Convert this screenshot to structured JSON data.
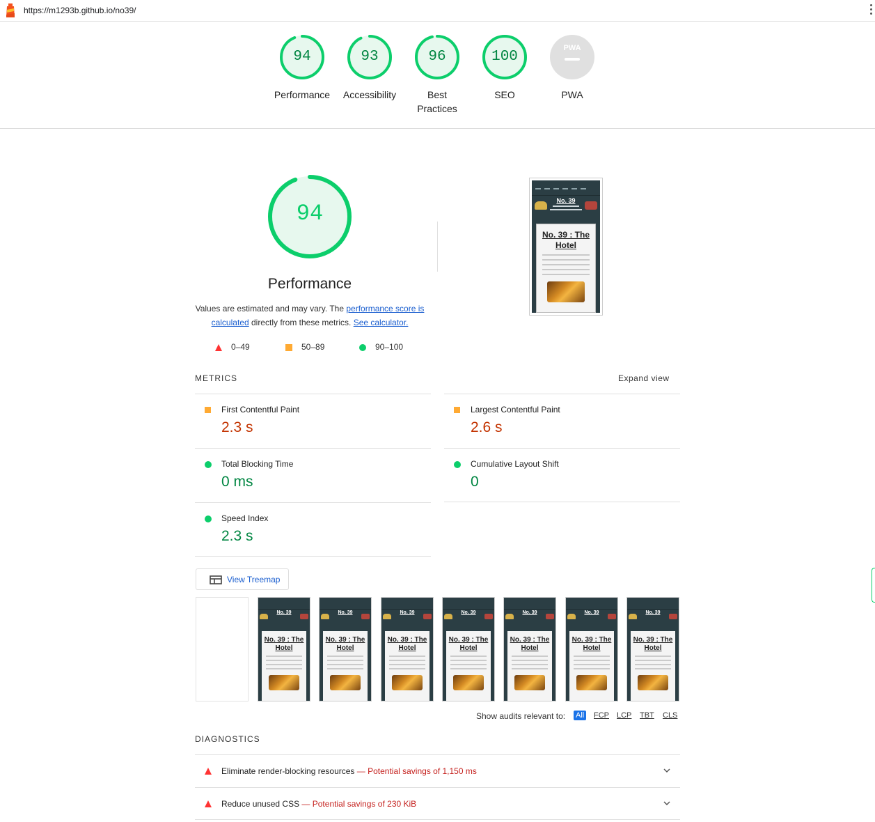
{
  "browser": {
    "url": "https://m1293b.github.io/no39/",
    "logo_icon": "lighthouse-icon"
  },
  "gauges": [
    {
      "label": "Performance",
      "score": "94",
      "color": "#0cce6b"
    },
    {
      "label": "Accessibility",
      "score": "93",
      "color": "#0cce6b"
    },
    {
      "label": "Best Practices",
      "score": "96",
      "color": "#0cce6b"
    },
    {
      "label": "SEO",
      "score": "100",
      "color": "#0cce6b"
    },
    {
      "label": "PWA",
      "score": "",
      "badge": "PWA",
      "color": "#cccccc"
    }
  ],
  "performance": {
    "score": "94",
    "title": "Performance",
    "desc_pre": "Values are estimated and may vary. The ",
    "link_score": "performance score is calculated",
    "desc_mid": " directly from these metrics. ",
    "link_calc": "See calculator.",
    "legend": [
      {
        "icon": "red-triangle-icon",
        "range": "0–49",
        "color": "#ff3333"
      },
      {
        "icon": "orange-square-icon",
        "range": "50–89",
        "color": "#ffaa33"
      },
      {
        "icon": "green-circle-icon",
        "range": "90–100",
        "color": "#0cce6b"
      }
    ]
  },
  "final_screenshot": {
    "site_title": "No. 39",
    "headline": "No. 39 : The Hotel"
  },
  "metrics": {
    "title": "METRICS",
    "expand": "Expand view",
    "items": [
      {
        "label": "First Contentful Paint",
        "value": "2.3 s",
        "rating": "average"
      },
      {
        "label": "Largest Contentful Paint",
        "value": "2.6 s",
        "rating": "average"
      },
      {
        "label": "Total Blocking Time",
        "value": "0 ms",
        "rating": "pass"
      },
      {
        "label": "Cumulative Layout Shift",
        "value": "0",
        "rating": "pass"
      },
      {
        "label": "Speed Index",
        "value": "2.3 s",
        "rating": "pass"
      }
    ]
  },
  "treemap": {
    "label": "View Treemap",
    "icon": "treemap-icon"
  },
  "filmstrip": {
    "frames": 8,
    "site_title": "No. 39",
    "headline_1": "No. 39 : The",
    "headline_2": "Hotel"
  },
  "audit_filter": {
    "label": "Show audits relevant to:",
    "options": [
      "All",
      "FCP",
      "LCP",
      "TBT",
      "CLS"
    ],
    "selected": "All"
  },
  "diagnostics": {
    "title": "DIAGNOSTICS",
    "items": [
      {
        "title": "Eliminate render-blocking resources",
        "savings": "— Potential savings of 1,150 ms",
        "icon": "red-triangle-icon"
      },
      {
        "title": "Reduce unused CSS",
        "savings": "— Potential savings of 230 KiB",
        "icon": "red-triangle-icon"
      }
    ]
  },
  "colors": {
    "pass": "#0cce6b",
    "average": "#ffaa33",
    "fail": "#ff3333",
    "link": "#1a5ecf"
  }
}
